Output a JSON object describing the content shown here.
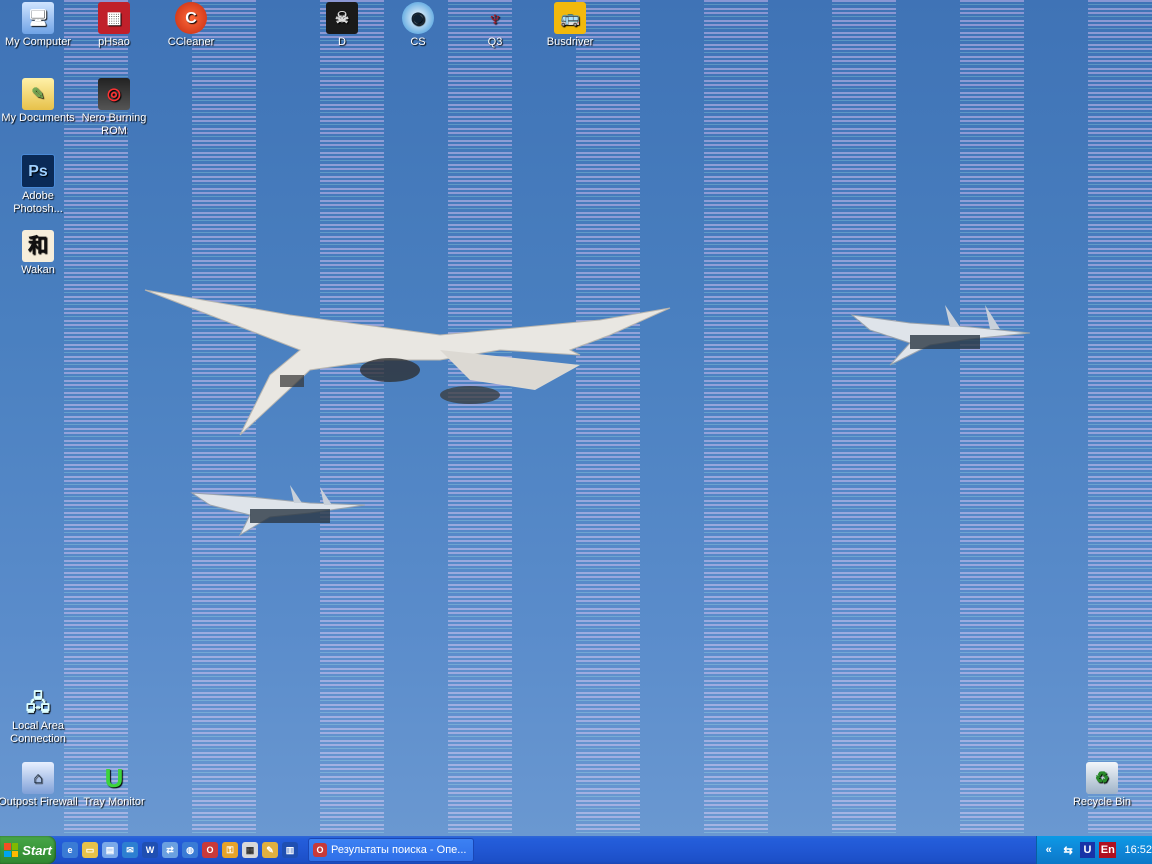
{
  "desktop": {
    "icons_top": [
      {
        "label": "My Computer",
        "icon": "computer-icon"
      },
      {
        "label": "pHsao",
        "icon": "app-red-icon"
      },
      {
        "label": "CCleaner",
        "icon": "ccleaner-icon"
      },
      {
        "label": "D",
        "icon": "skull-icon"
      },
      {
        "label": "CS",
        "icon": "cs-icon"
      },
      {
        "label": "Q3",
        "icon": "q3-icon"
      },
      {
        "label": "Busdriver",
        "icon": "bus-icon"
      }
    ],
    "icons_left": [
      {
        "label": "My Documents",
        "icon": "folder-icon"
      },
      {
        "label": "Nero Burning ROM",
        "icon": "nero-icon"
      },
      {
        "label": "Adobe Photosh...",
        "icon": "photoshop-icon"
      },
      {
        "label": "Wakan",
        "icon": "wakan-icon"
      },
      {
        "label": "Local Area Connection",
        "icon": "network-icon"
      },
      {
        "label": "Outpost Firewall",
        "icon": "firewall-icon"
      },
      {
        "label": "Tray Monitor",
        "icon": "tray-monitor-icon"
      }
    ],
    "recycle": {
      "label": "Recycle Bin",
      "icon": "recycle-bin-icon"
    }
  },
  "taskbar": {
    "start_label": "Start",
    "task_button_label": "Результаты поиска - Опе...",
    "tray": {
      "lang": "En",
      "clock": "16:52"
    }
  },
  "colors": {
    "desktop_blue": "#4a80c0",
    "taskbar_blue": "#245edb",
    "start_green": "#3c9a3c",
    "tray_blue": "#0f87d8"
  }
}
